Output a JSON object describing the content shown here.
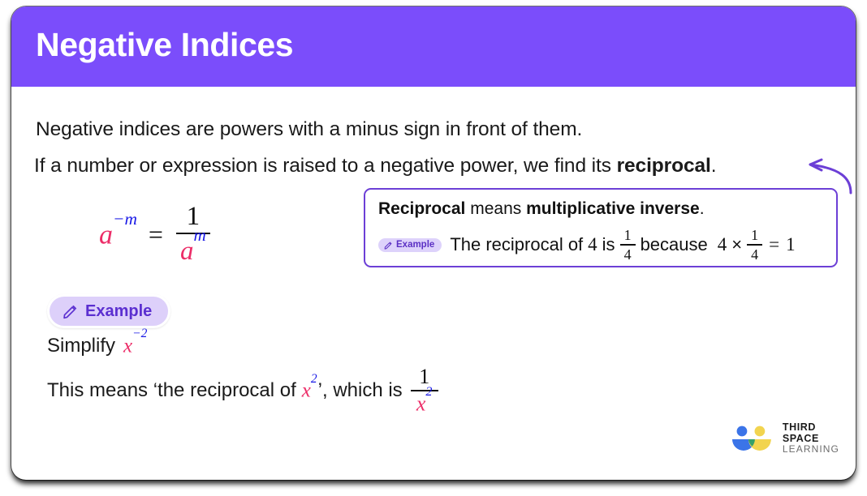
{
  "slide": {
    "header": {
      "title": "Negative Indices",
      "background_color": "#7b4dfb",
      "text_color": "#ffffff"
    },
    "body": {
      "para1": "Negative indices are powers with a minus sign in front of them.",
      "para2_prefix": "If a number or expression is raised to a negative power, we find its ",
      "para2_bold": "reciprocal",
      "para2_suffix": "."
    },
    "main_formula": {
      "base": "a",
      "exponent": "−m",
      "equals": "=",
      "numerator": "1",
      "denominator_base": "a",
      "denominator_exponent": "m",
      "base_color": "#ec2d68",
      "exponent_color": "#1919e6"
    },
    "callout": {
      "border_color": "#6c3fd6",
      "line1_bold1": "Reciprocal",
      "line1_mid": " means ",
      "line1_bold2": "multiplicative inverse",
      "line1_end": ".",
      "badge": {
        "icon": "pencil-icon",
        "label": "Example",
        "background_color": "#ddd2fb",
        "text_color": "#5b30c4"
      },
      "line2_text1": "The reciprocal of",
      "line2_value1": "4",
      "line2_text2": "is",
      "line2_frac1_num": "1",
      "line2_frac1_den": "4",
      "line2_text3": "because",
      "line2_value2": "4",
      "line2_times": "×",
      "line2_frac2_num": "1",
      "line2_frac2_den": "4",
      "line2_equals": "=",
      "line2_result": "1"
    },
    "example_badge": {
      "icon": "pencil-icon",
      "label": "Example",
      "background_color": "#ddd0fa",
      "text_color": "#5b2fd0"
    },
    "simplify": {
      "label": "Simplify",
      "expr_base": "x",
      "expr_exponent": "−2"
    },
    "explanation": {
      "text1": "This means ‘the reciprocal of",
      "expr_base": "x",
      "expr_exponent": "2",
      "text2": "’, which is",
      "frac_num": "1",
      "frac_den_base": "x",
      "frac_den_exponent": "2"
    },
    "arrow": {
      "name": "curved-arrow",
      "color": "#6c3fd6"
    },
    "logo": {
      "line1": "THIRD SPACE",
      "line2": "LEARNING",
      "blue": "#3b74e8",
      "yellow": "#f2d44f",
      "green": "#34a06a"
    }
  }
}
